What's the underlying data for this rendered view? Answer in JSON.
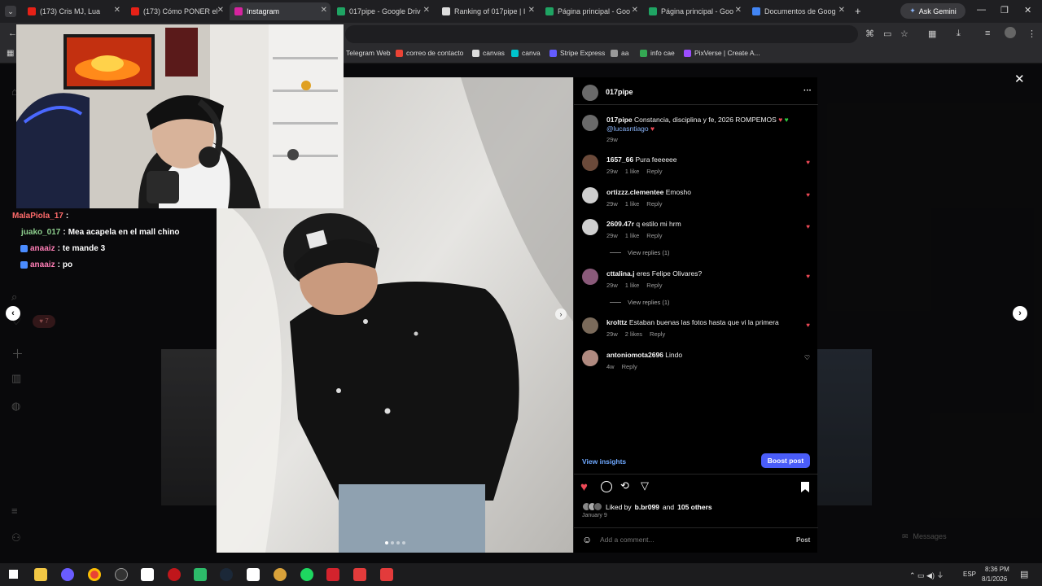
{
  "browser": {
    "tabs": [
      {
        "label": "(173) Cris MJ, Lua",
        "color": "#e62117",
        "active": false
      },
      {
        "label": "(173) Cómo PONER el",
        "color": "#e62117",
        "active": false
      },
      {
        "label": "Instagram",
        "color": "#d6249f",
        "active": true
      },
      {
        "label": "017pipe - Google Driv",
        "color": "#1fa463",
        "active": false
      },
      {
        "label": "Ranking of 017pipe | I",
        "color": "#dddddd",
        "active": false
      },
      {
        "label": "Página principal - Goo",
        "color": "#1fa463",
        "active": false
      },
      {
        "label": "Página principal - Goo",
        "color": "#1fa463",
        "active": false
      },
      {
        "label": "Documentos de Goog",
        "color": "#4285f4",
        "active": false
      }
    ],
    "new_tab_label": "+",
    "gemini_label": "Ask Gemini",
    "bookmarks": [
      {
        "label": "Telegram Web",
        "color": "#2aa3de"
      },
      {
        "label": "correo de contacto",
        "color": "#ea4335"
      },
      {
        "label": "canvas",
        "color": "#dddddd"
      },
      {
        "label": "canva",
        "color": "#00c4cc"
      },
      {
        "label": "Stripe Express",
        "color": "#635bff"
      },
      {
        "label": "aa",
        "color": "#999999"
      },
      {
        "label": "info cae",
        "color": "#34a853"
      },
      {
        "label": "PixVerse | Create A...",
        "color": "#9b4dff"
      }
    ]
  },
  "chat": {
    "messages": [
      {
        "user": "MalaPiola_17",
        "text": "",
        "color": "#ff6b6b"
      },
      {
        "user": "juako_017",
        "text": "Mea acapela en el mall chino",
        "color": "#8fd18f"
      },
      {
        "user": "anaaiz",
        "text": "te mande 3",
        "color": "#ff7eb6"
      },
      {
        "user": "anaaiz",
        "text": "po",
        "color": "#ff7eb6"
      }
    ],
    "separator": ":"
  },
  "post": {
    "username": "017pipe",
    "caption_user": "017pipe",
    "caption_text": "Constancia, disciplina y fe, 2026 ROMPEMOS",
    "caption_mention": "@lucasntiago",
    "caption_time": "29w",
    "comments": [
      {
        "user": "1657_66",
        "text": "Pura feeeeee",
        "time": "29w",
        "likes": "1 like",
        "reply": "Reply",
        "liked": true,
        "avatar": "#6b4a3a"
      },
      {
        "user": "ortizzz.clementee",
        "text": "Emosho",
        "time": "29w",
        "likes": "1 like",
        "reply": "Reply",
        "liked": true,
        "avatar": "#cfcfcf"
      },
      {
        "user": "2609.47r",
        "text": "q estilo mi hrm",
        "time": "29w",
        "likes": "1 like",
        "reply": "Reply",
        "liked": true,
        "avatar": "#cfcfcf",
        "view_replies": "View replies (1)"
      },
      {
        "user": "cttalina.j",
        "text": "eres Felipe Olivares?",
        "time": "29w",
        "likes": "1 like",
        "reply": "Reply",
        "liked": true,
        "avatar": "#8a5a7a",
        "view_replies": "View replies (1)"
      },
      {
        "user": "krolttz",
        "text": "Estaban buenas las fotos hasta que vi la primera",
        "time": "29w",
        "likes": "2 likes",
        "reply": "Reply",
        "liked": true,
        "avatar": "#7a6a5a"
      },
      {
        "user": "antoniomota2696",
        "text": "Lindo",
        "time": "4w",
        "likes": "",
        "reply": "Reply",
        "liked": false,
        "avatar": "#b08a80"
      }
    ],
    "view_insights": "View insights",
    "boost_post": "Boost post",
    "liked_by_prefix": "Liked by",
    "liked_by_user": "b.br099",
    "liked_by_and": "and",
    "liked_by_others": "105 others",
    "date": "January 9",
    "comment_placeholder": "Add a comment...",
    "post_button": "Post",
    "more": "···"
  },
  "messages_label": "Messages",
  "notification_badge": "7",
  "taskbar": {
    "lang": "ESP",
    "time": "8:36 PM",
    "date": "8/1/2026"
  }
}
